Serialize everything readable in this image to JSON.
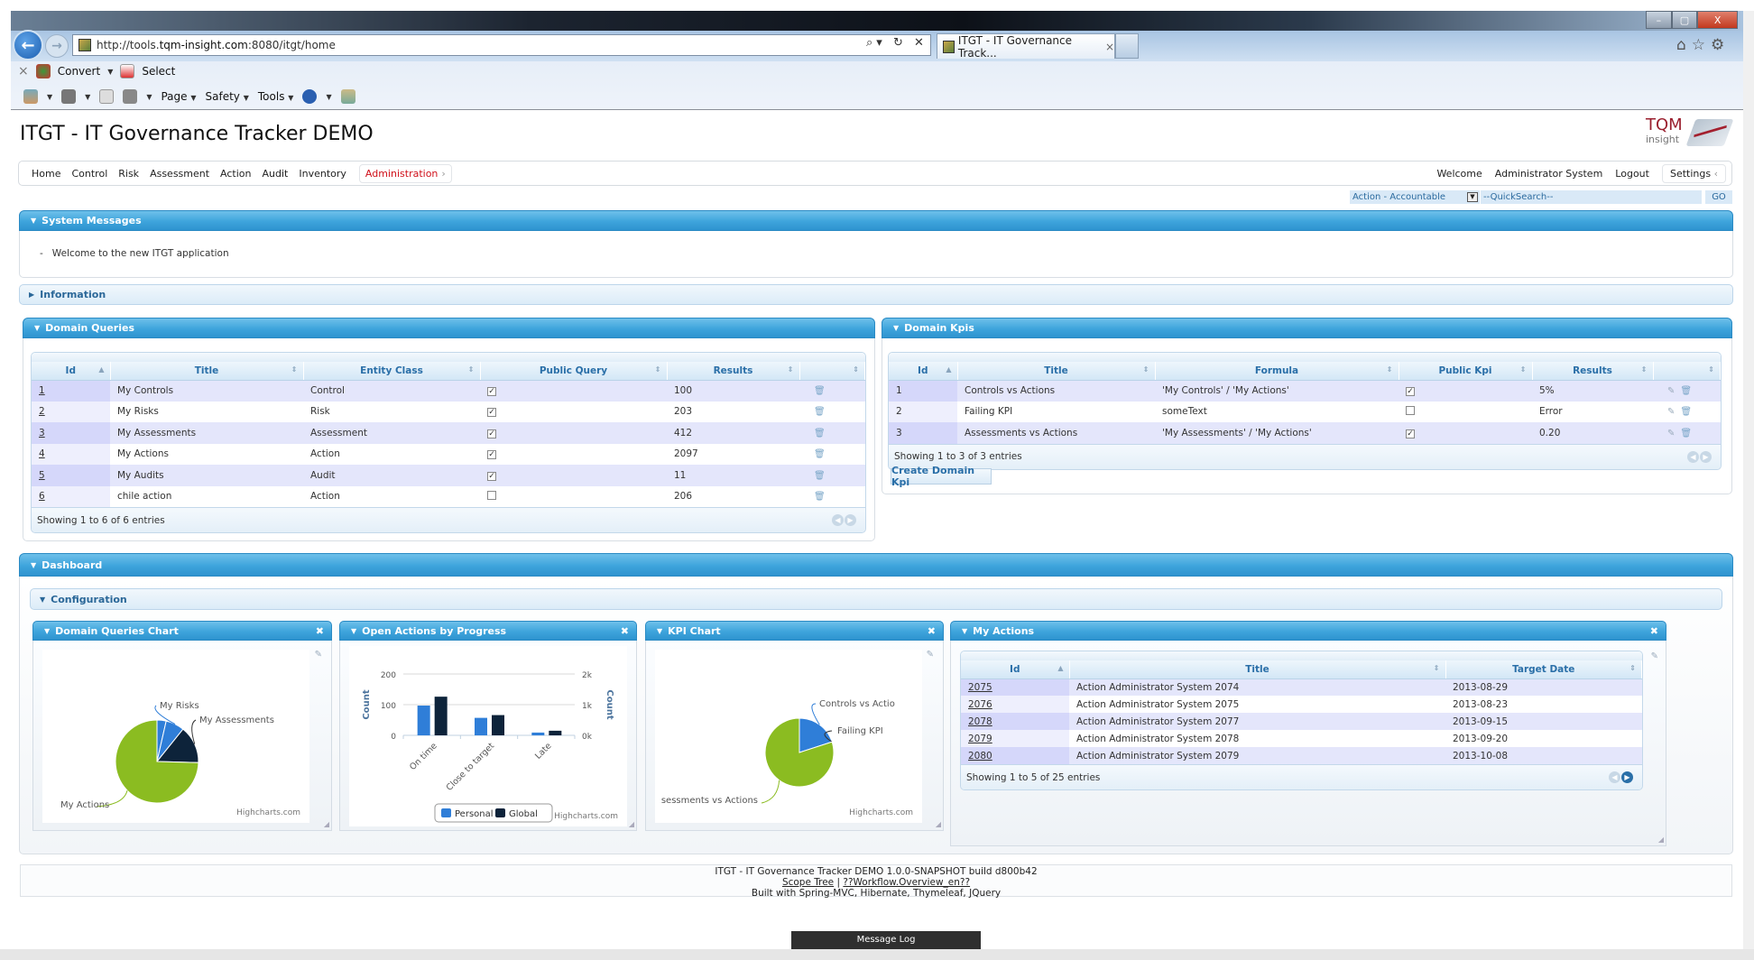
{
  "browser": {
    "url_prefix": "http://tools.",
    "url_host": "tqm-insight.com",
    "url_suffix": ":8080/itgt/home",
    "addr_tools": "⌕▾ ↻ ✕",
    "tab_title": "ITGT - IT Governance Track...",
    "tab_close": "×",
    "window_controls": {
      "minimize": "–",
      "restore": "▢",
      "close": "X"
    },
    "right_icons": "⌂☆⚙",
    "cmdbar1": {
      "close": "×",
      "convert": "Convert",
      "select": "Select"
    },
    "cmdbar2": {
      "page": "Page",
      "safety": "Safety",
      "tools": "Tools"
    }
  },
  "app": {
    "title": "ITGT - IT Governance Tracker DEMO",
    "logo_top": "TQM",
    "logo_bottom": "insight"
  },
  "nav": {
    "items": [
      "Home",
      "Control",
      "Risk",
      "Assessment",
      "Action",
      "Audit",
      "Inventory"
    ],
    "active": "Administration",
    "active_chevron": "›",
    "welcome": "Welcome",
    "user": "Administrator System",
    "logout": "Logout",
    "settings": "Settings",
    "settings_chevron": "‹"
  },
  "quicksearch": {
    "selected": "Action - Accountable",
    "placeholder": "--QuickSearch--",
    "go": "GO"
  },
  "system_messages": {
    "title": "System Messages",
    "bullet": "-",
    "message": "Welcome to the new ITGT application"
  },
  "information": {
    "title": "Information"
  },
  "domain_queries": {
    "title": "Domain Queries",
    "columns": [
      "Id",
      "Title",
      "Entity Class",
      "Public Query",
      "Results",
      ""
    ],
    "rows": [
      {
        "id": "1",
        "title": "My Controls",
        "entity": "Control",
        "public": true,
        "results": "100"
      },
      {
        "id": "2",
        "title": "My Risks",
        "entity": "Risk",
        "public": true,
        "results": "203"
      },
      {
        "id": "3",
        "title": "My Assessments",
        "entity": "Assessment",
        "public": true,
        "results": "412"
      },
      {
        "id": "4",
        "title": "My Actions",
        "entity": "Action",
        "public": true,
        "results": "2097"
      },
      {
        "id": "5",
        "title": "My Audits",
        "entity": "Audit",
        "public": true,
        "results": "11"
      },
      {
        "id": "6",
        "title": "chile action",
        "entity": "Action",
        "public": false,
        "results": "206"
      }
    ],
    "footer": "Showing 1 to 6 of 6 entries"
  },
  "domain_kpis": {
    "title": "Domain Kpis",
    "columns": [
      "Id",
      "Title",
      "Formula",
      "Public Kpi",
      "Results",
      ""
    ],
    "rows": [
      {
        "id": "1",
        "title": "Controls vs Actions",
        "formula": "'My Controls' / 'My Actions'",
        "public": true,
        "results": "5%"
      },
      {
        "id": "2",
        "title": "Failing KPI",
        "formula": "someText",
        "public": false,
        "results": "Error"
      },
      {
        "id": "3",
        "title": "Assessments vs Actions",
        "formula": "'My Assessments' / 'My Actions'",
        "public": true,
        "results": "0.20"
      }
    ],
    "footer": "Showing 1 to 3 of 3 entries",
    "create_button": "Create Domain Kpi"
  },
  "dashboard": {
    "title": "Dashboard",
    "configuration": "Configuration",
    "credit": "Highcharts.com",
    "widgets": {
      "domain_queries_chart": "Domain Queries Chart",
      "open_actions": "Open Actions by Progress",
      "kpi_chart": "KPI Chart",
      "my_actions": "My Actions"
    },
    "my_actions": {
      "columns": [
        "Id",
        "Title",
        "Target Date"
      ],
      "rows": [
        {
          "id": "2075",
          "title": "Action Administrator System 2074",
          "date": "2013-08-29"
        },
        {
          "id": "2076",
          "title": "Action Administrator System 2075",
          "date": "2013-08-23"
        },
        {
          "id": "2078",
          "title": "Action Administrator System 2077",
          "date": "2013-09-15"
        },
        {
          "id": "2079",
          "title": "Action Administrator System 2078",
          "date": "2013-09-20"
        },
        {
          "id": "2080",
          "title": "Action Administrator System 2079",
          "date": "2013-10-08"
        }
      ],
      "footer": "Showing 1 to 5 of 25 entries"
    }
  },
  "chart_data": [
    {
      "type": "pie",
      "title": "Domain Queries Chart",
      "slices": [
        {
          "label": "My Controls",
          "value": 100,
          "color": "#2f7ed8",
          "show_label": false
        },
        {
          "label": "My Risks",
          "value": 203,
          "color": "#2f7ed8",
          "show_label": true
        },
        {
          "label": "My Assessments",
          "value": 412,
          "color": "#0d233a",
          "show_label": true
        },
        {
          "label": "My Actions",
          "value": 2097,
          "color": "#8bbc21",
          "show_label": true
        }
      ]
    },
    {
      "type": "bar",
      "title": "Open Actions by Progress",
      "categories": [
        "On time",
        "Close to target",
        "Late"
      ],
      "series": [
        {
          "name": "Personal",
          "axis": "left",
          "color": "#2f7ed8",
          "values": [
            97,
            57,
            9
          ]
        },
        {
          "name": "Global",
          "axis": "right",
          "color": "#0d233a",
          "values": [
            1260,
            660,
            150
          ]
        }
      ],
      "ylabel_left": "Count",
      "ylabel_right": "Count",
      "ylim_left": [
        0,
        200
      ],
      "ylim_right": [
        0,
        2000
      ],
      "yticks_left": [
        "0",
        "100",
        "200"
      ],
      "yticks_right": [
        "0k",
        "1k",
        "2k"
      ],
      "legend": "bottom-center",
      "grid": true
    },
    {
      "type": "pie",
      "title": "KPI Chart",
      "slices": [
        {
          "label": "Controls vs Actio",
          "value": 0.05,
          "color": "#2f7ed8"
        },
        {
          "label": "Failing KPI",
          "value": 0,
          "color": "#0d233a"
        },
        {
          "label": "sessments vs Actions",
          "value": 0.2,
          "color": "#8bbc21"
        }
      ]
    }
  ],
  "footer": {
    "line1": "ITGT - IT Governance Tracker DEMO 1.0.0-SNAPSHOT build d800b42",
    "link1": "Scope Tree",
    "sep": "|",
    "link2": "??Workflow.Overview_en??",
    "line3": "Built with Spring-MVC, Hibernate, Thymeleaf, JQuery"
  },
  "message_log": "Message Log"
}
